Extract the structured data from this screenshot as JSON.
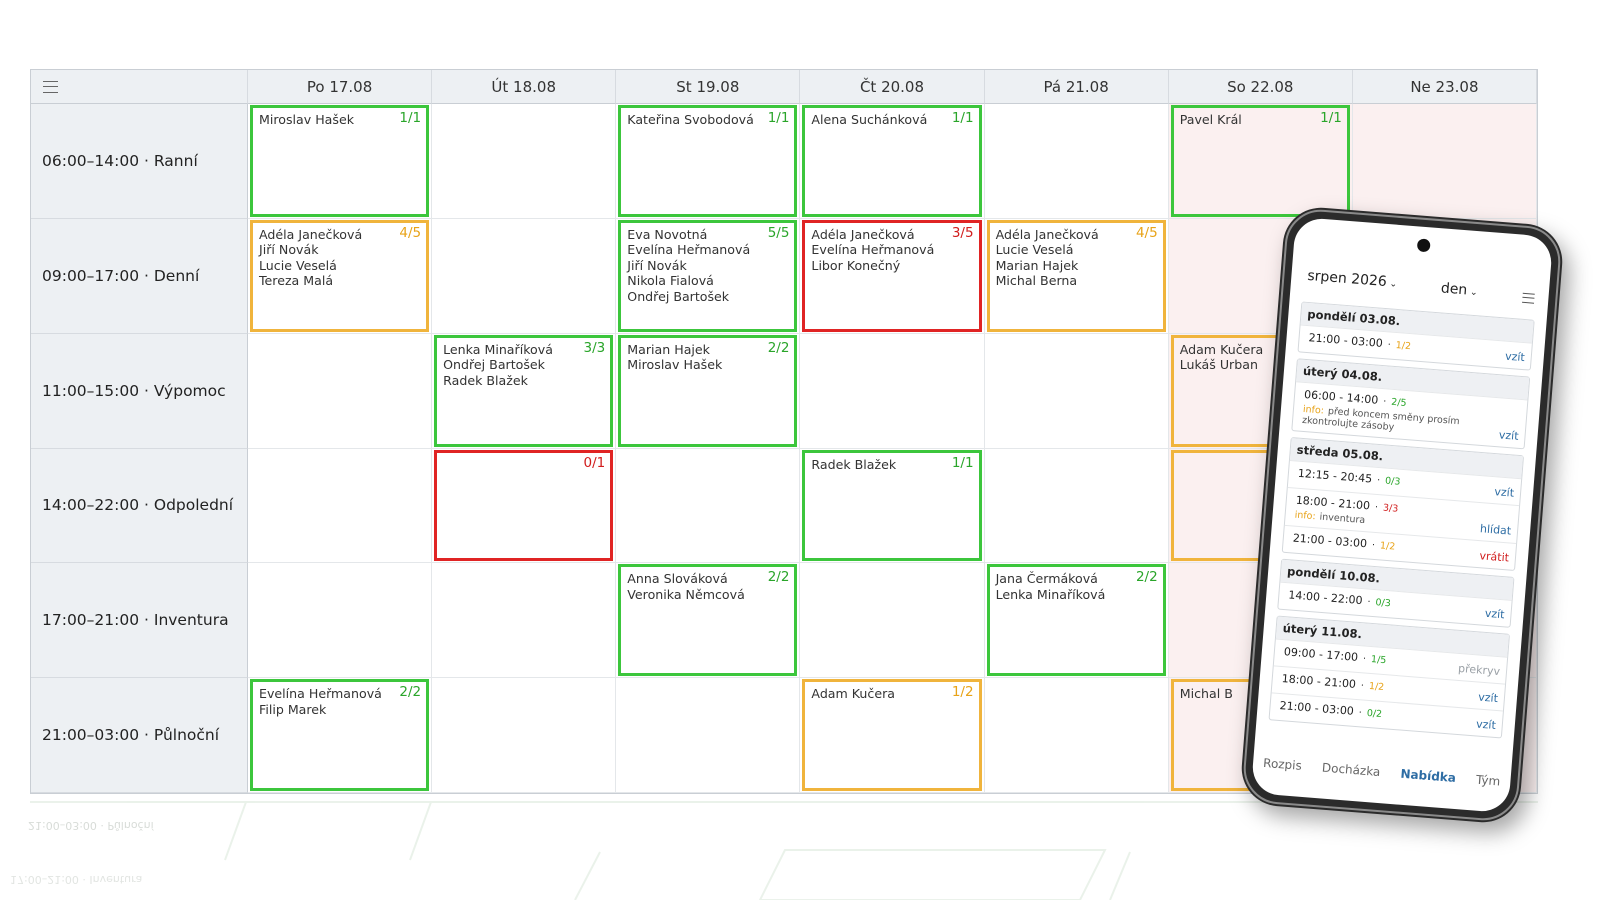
{
  "days": [
    "Po 17.08",
    "Út 18.08",
    "St 19.08",
    "Čt 20.08",
    "Pá 21.08",
    "So 22.08",
    "Ne 23.08"
  ],
  "shifts": [
    {
      "label": "06:00–14:00 · Ranní"
    },
    {
      "label": "09:00–17:00 · Denní"
    },
    {
      "label": "11:00–15:00 · Výpomoc"
    },
    {
      "label": "14:00–22:00 · Odpolední"
    },
    {
      "label": "17:00–21:00 · Inventura"
    },
    {
      "label": "21:00–03:00 · Půlnoční"
    }
  ],
  "cells": [
    {
      "row": 0,
      "col": 0,
      "count": "1/1",
      "status": "ok",
      "names": [
        "Miroslav Hašek"
      ]
    },
    {
      "row": 0,
      "col": 2,
      "count": "1/1",
      "status": "ok",
      "names": [
        "Kateřina Svobodová"
      ]
    },
    {
      "row": 0,
      "col": 3,
      "count": "1/1",
      "status": "ok",
      "names": [
        "Alena Suchánková"
      ]
    },
    {
      "row": 0,
      "col": 5,
      "count": "1/1",
      "status": "ok",
      "names": [
        "Pavel Král"
      ]
    },
    {
      "row": 1,
      "col": 0,
      "count": "4/5",
      "status": "warn",
      "names": [
        "Adéla Janečková",
        "Jiří Novák",
        "Lucie Veselá",
        "Tereza Malá"
      ]
    },
    {
      "row": 1,
      "col": 2,
      "count": "5/5",
      "status": "ok",
      "names": [
        "Eva Novotná",
        "Evelína Heřmanová",
        "Jiří Novák",
        "Nikola Fialová",
        "Ondřej Bartošek"
      ]
    },
    {
      "row": 1,
      "col": 3,
      "count": "3/5",
      "status": "bad",
      "names": [
        "Adéla Janečková",
        "Evelína Heřmanová",
        "Libor Konečný"
      ]
    },
    {
      "row": 1,
      "col": 4,
      "count": "4/5",
      "status": "warn",
      "names": [
        "Adéla Janečková",
        "Lucie Veselá",
        "Marian Hajek",
        "Michal Berna"
      ]
    },
    {
      "row": 2,
      "col": 1,
      "count": "3/3",
      "status": "ok",
      "names": [
        "Lenka Minaříková",
        "Ondřej Bartošek",
        "Radek Blažek"
      ]
    },
    {
      "row": 2,
      "col": 2,
      "count": "2/2",
      "status": "ok",
      "names": [
        "Marian Hajek",
        "Miroslav Hašek"
      ]
    },
    {
      "row": 2,
      "col": 5,
      "count": "",
      "status": "warn",
      "names": [
        "Adam Kučera",
        "Lukáš Urban"
      ]
    },
    {
      "row": 3,
      "col": 1,
      "count": "0/1",
      "status": "bad",
      "names": []
    },
    {
      "row": 3,
      "col": 3,
      "count": "1/1",
      "status": "ok",
      "names": [
        "Radek Blažek"
      ]
    },
    {
      "row": 3,
      "col": 5,
      "count": "",
      "status": "warn",
      "names": []
    },
    {
      "row": 4,
      "col": 2,
      "count": "2/2",
      "status": "ok",
      "names": [
        "Anna Slováková",
        "Veronika Němcová"
      ]
    },
    {
      "row": 4,
      "col": 4,
      "count": "2/2",
      "status": "ok",
      "names": [
        "Jana Čermáková",
        "Lenka Minaříková"
      ]
    },
    {
      "row": 5,
      "col": 0,
      "count": "2/2",
      "status": "ok",
      "names": [
        "Evelína Heřmanová",
        "Filip Marek"
      ]
    },
    {
      "row": 5,
      "col": 3,
      "count": "1/2",
      "status": "warn",
      "names": [
        "Adam Kučera"
      ]
    },
    {
      "row": 5,
      "col": 5,
      "count": "",
      "status": "warn",
      "names": [
        "Michal B"
      ]
    }
  ],
  "reflection": {
    "label_1": "21:00–03:00 · Půlnoční",
    "label_2": "17:00–21:00 · Inventura"
  },
  "phone": {
    "month": "srpen 2026",
    "view": "den",
    "days": [
      {
        "date": "pondělí 03.08.",
        "rows": [
          {
            "time": "21:00 - 03:00",
            "count": "1/2",
            "status": "warn",
            "action": "vzít",
            "action_style": "blue"
          }
        ]
      },
      {
        "date": "úterý 04.08.",
        "rows": [
          {
            "time": "06:00 - 14:00",
            "count": "2/5",
            "status": "ok",
            "info_label": "info:",
            "info": "před koncem směny prosím zkontrolujte zásoby",
            "action": "vzít",
            "action_style": "blue"
          }
        ]
      },
      {
        "date": "středa 05.08.",
        "rows": [
          {
            "time": "12:15 - 20:45",
            "count": "0/3",
            "status": "ok",
            "action": "vzít",
            "action_style": "blue"
          },
          {
            "time": "18:00 - 21:00",
            "count": "3/3",
            "status": "bad",
            "info_label": "info:",
            "info": "inventura",
            "action": "hlídat",
            "action_style": "blue"
          },
          {
            "time": "21:00 - 03:00",
            "count": "1/2",
            "status": "warn",
            "action": "vrátit",
            "action_style": "red"
          }
        ]
      },
      {
        "date": "pondělí 10.08.",
        "rows": [
          {
            "time": "14:00 - 22:00",
            "count": "0/3",
            "status": "ok",
            "action": "vzít",
            "action_style": "blue"
          }
        ]
      },
      {
        "date": "úterý 11.08.",
        "rows": [
          {
            "time": "09:00 - 17:00",
            "count": "1/5",
            "status": "ok",
            "action": "překryv",
            "action_style": "grey"
          },
          {
            "time": "18:00 - 21:00",
            "count": "1/2",
            "status": "warn",
            "action": "vzít",
            "action_style": "blue"
          },
          {
            "time": "21:00 - 03:00",
            "count": "0/2",
            "status": "ok",
            "action": "vzít",
            "action_style": "blue"
          }
        ]
      }
    ],
    "nav": [
      {
        "label": "Rozpis",
        "active": false
      },
      {
        "label": "Docházka",
        "active": false
      },
      {
        "label": "Nabídka",
        "active": true
      },
      {
        "label": "Tým",
        "active": false
      }
    ]
  },
  "colors": {
    "ok": "#3cc63c",
    "warn": "#f0b43c",
    "bad": "#e02424",
    "accent": "#2e6da4"
  }
}
